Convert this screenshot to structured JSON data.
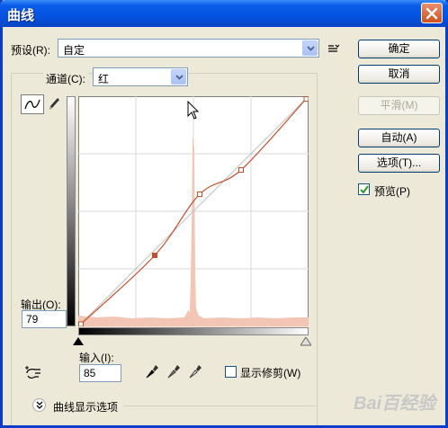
{
  "window": {
    "title": "曲线"
  },
  "preset": {
    "label": "预设(R):",
    "value": "自定"
  },
  "channel": {
    "label": "通道(C):",
    "value": "红"
  },
  "buttons": {
    "ok": "确定",
    "cancel": "取消",
    "smooth": "平滑(M)",
    "auto": "自动(A)",
    "options": "选项(T)..."
  },
  "preview": {
    "label": "预览(P)",
    "checked": true
  },
  "output": {
    "label": "输出(O):",
    "value": "79"
  },
  "input": {
    "label": "输入(I):",
    "value": "85"
  },
  "clipping": {
    "label": "显示修剪(W)",
    "checked": false
  },
  "curve_options": {
    "label": "曲线显示选项"
  },
  "watermark": {
    "text": "Bai百经验"
  },
  "curve": {
    "color": "#c0502c",
    "points": [
      [
        0,
        0
      ],
      [
        85,
        79
      ],
      [
        135,
        147
      ],
      [
        181,
        174
      ],
      [
        255,
        255
      ]
    ]
  },
  "colors": {
    "accent": "#0a5ce8",
    "histogram": "#f0c0b0"
  }
}
